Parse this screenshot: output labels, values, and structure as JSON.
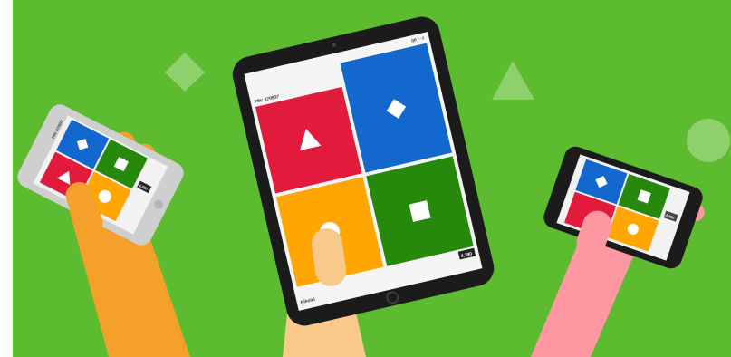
{
  "colors": {
    "background": "#5dbb30",
    "red": "#e21b3c",
    "blue": "#1368ce",
    "yellow": "#ffa602",
    "green": "#26890c",
    "device_dark": "#1b1b1b",
    "device_light": "#cfcfcf",
    "arm_orange": "#f5a02a",
    "arm_tan": "#f8c98a",
    "arm_pink": "#ff97a3",
    "deco": "#8ed06c"
  },
  "tablet": {
    "pin_label": "PIN: 870937",
    "top_right_label": "QB ⋯ 2",
    "score_label": "4,390",
    "player_label": "Nikolai"
  },
  "phone_left": {
    "pin_label": "PIN: 870937",
    "top_right_label": "QB ⋯ 2",
    "score_label": "4,390",
    "player_label": "Nikolai"
  },
  "phone_right": {
    "pin_label": "PIN: 870937",
    "top_right_label": "QB ⋯ 2",
    "score_label": "4,390",
    "player_label": "Nikolai"
  },
  "answer_shapes": [
    "triangle-icon",
    "diamond-icon",
    "circle-icon",
    "square-icon"
  ]
}
